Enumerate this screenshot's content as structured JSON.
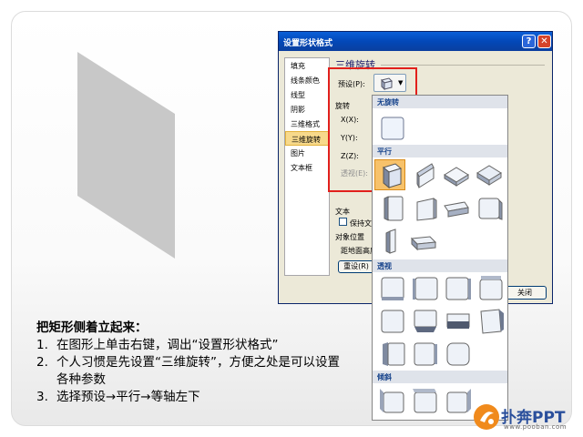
{
  "dialog": {
    "title": "设置形状格式",
    "help_label": "?",
    "close_label": "✕",
    "nav_items": [
      {
        "label": "填充"
      },
      {
        "label": "线条颜色"
      },
      {
        "label": "线型"
      },
      {
        "label": "阴影"
      },
      {
        "label": "三维格式"
      },
      {
        "label": "三维旋转",
        "active": true
      },
      {
        "label": "图片"
      },
      {
        "label": "文本框"
      }
    ],
    "section_title": "三维旋转",
    "preset_label": "预设(P):",
    "rotation_label": "旋转",
    "x_label": "X(X):",
    "y_label": "Y(Y):",
    "z_label": "Z(Z):",
    "perspective_label": "透视(E):",
    "text_label": "文本",
    "keep_text_flat_label": "保持文",
    "object_position_label": "对象位置",
    "distance_label": "距地面高度",
    "reset_label": "重设(R)",
    "close_button_label": "关闭"
  },
  "gallery": {
    "sections": [
      {
        "title": "无旋转"
      },
      {
        "title": "平行"
      },
      {
        "title": "透视"
      },
      {
        "title": "倾斜"
      }
    ],
    "selected_tile": "平行-1"
  },
  "notes": {
    "title": "把矩形侧着立起来：",
    "items": [
      {
        "num": "1.",
        "text": "在图形上单击右键，调出“设置形状格式”"
      },
      {
        "num": "2.",
        "text": "个人习惯是先设置“三维旋转”，方便之处是可以设置各种参数"
      },
      {
        "num": "3.",
        "text": "选择预设→平行→等轴左下"
      }
    ]
  },
  "logo": {
    "text": "扑奔PPT",
    "url": "www.pooban.com",
    "colors": {
      "orange": "#f08a1c",
      "blue": "#2a4f9c"
    }
  },
  "colors": {
    "highlight_red": "#e2201c",
    "xp_blue": "#0a5fd8",
    "selected_orange": "#f7c26b",
    "shape_gray": "#c8c8c8"
  }
}
